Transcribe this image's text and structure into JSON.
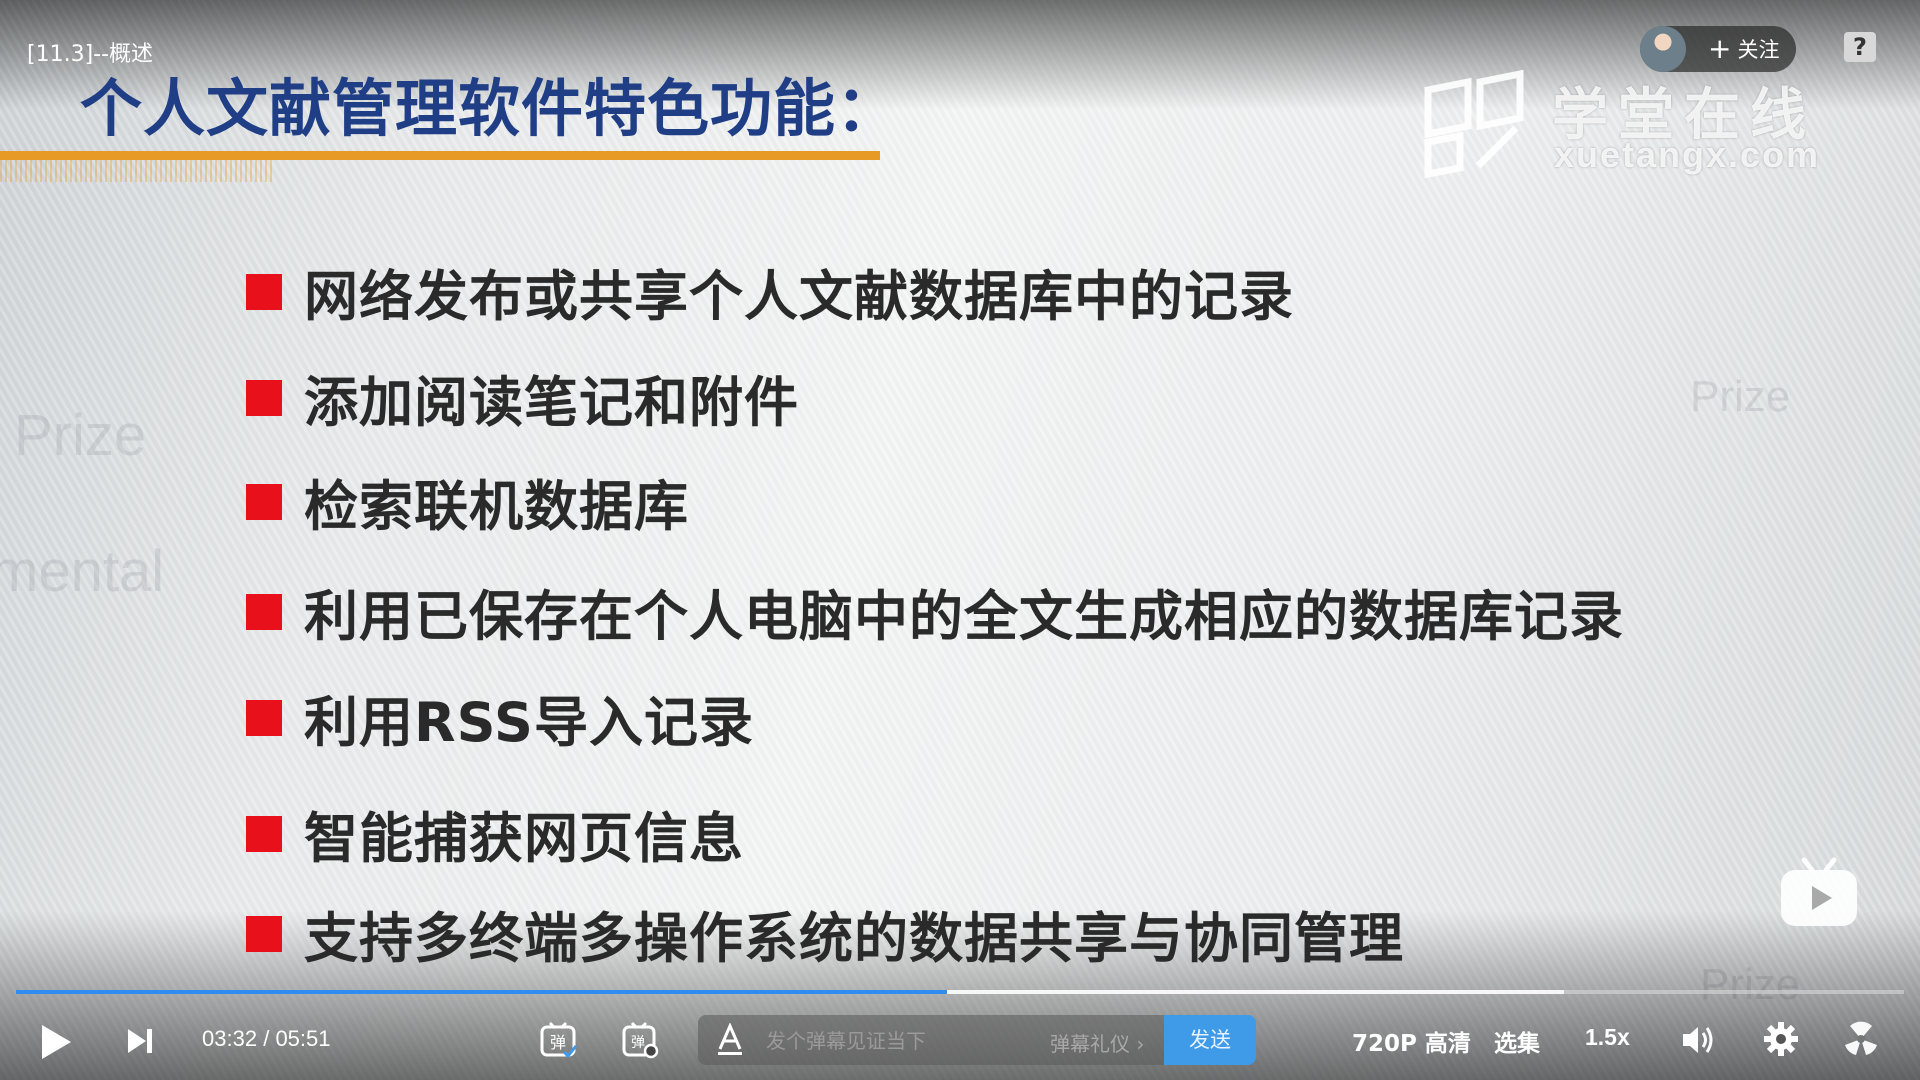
{
  "player": {
    "video_title": "[11.3]--概述",
    "follow_label": "关注",
    "follow_plus": "+",
    "help_label": "?",
    "progress_played_fraction": 0.493,
    "progress_buffered_fraction": 0.82,
    "time_current": "03:32",
    "time_separator": "/",
    "time_total": "05:51",
    "danmaku_placeholder": "发个弹幕见证当下",
    "danmaku_etiquette": "弹幕礼仪 ›",
    "danmaku_send": "发送",
    "quality": "720P 高清",
    "episodes": "选集",
    "speed": "1.5x",
    "accent_color": "#2f8df0"
  },
  "slide": {
    "title": "个人文献管理软件特色功能：",
    "title_color": "#1f3e86",
    "underline_color": "#e79a25",
    "bullet_color": "#e8101a",
    "logo_cn": "学堂在线",
    "logo_en": "xuetangx.com",
    "bullets": [
      "网络发布或共享个人文献数据库中的记录",
      "添加阅读笔记和附件",
      "检索联机数据库",
      "利用已保存在个人电脑中的全文生成相应的数据库记录",
      "利用RSS导入记录",
      "智能捕获网页信息",
      "支持多终端多操作系统的数据共享与协同管理"
    ]
  }
}
